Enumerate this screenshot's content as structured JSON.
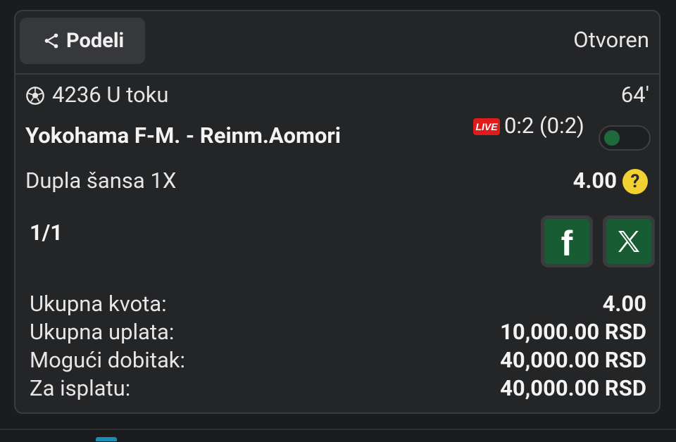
{
  "header": {
    "share_label": "Podeli",
    "status": "Otvoren"
  },
  "match": {
    "info": "4236 U toku",
    "minute": "64'",
    "teams": "Yokohama F-M. - Reinm.Aomori",
    "live_label": "LIVE",
    "score": "0:2 (0:2)",
    "market": "Dupla šansa 1X",
    "odd": "4.00",
    "help": "?"
  },
  "pager": "1/1",
  "social": {
    "facebook_glyph": "f",
    "facebook_icon": "facebook-icon",
    "x_icon": "x-icon"
  },
  "summary": {
    "rows": [
      {
        "label": "Ukupna kvota:",
        "value": "4.00"
      },
      {
        "label": "Ukupna uplata:",
        "value": "10,000.00 RSD"
      },
      {
        "label": "Mogući dobitak:",
        "value": "40,000.00 RSD"
      },
      {
        "label": "Za isplatu:",
        "value": "40,000.00 RSD"
      }
    ]
  },
  "colors": {
    "background": "#1b1c1e",
    "card": "#242527",
    "accent_green": "#175c32",
    "live_red": "#e01b1b",
    "help_yellow": "#f2d233"
  }
}
